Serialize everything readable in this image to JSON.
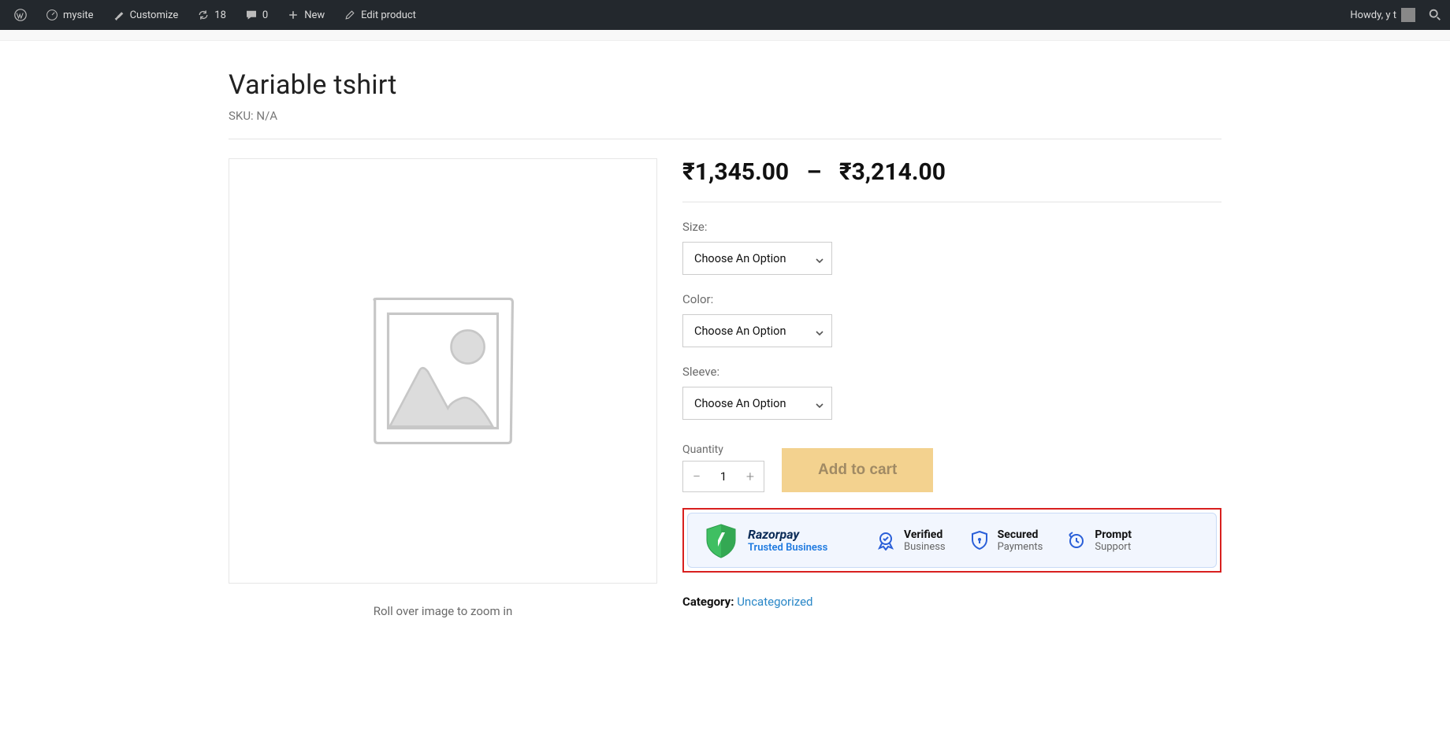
{
  "admin": {
    "site_name": "mysite",
    "customize": "Customize",
    "updates_count": "18",
    "comments_count": "0",
    "new": "New",
    "edit": "Edit product",
    "howdy": "Howdy, y t"
  },
  "product": {
    "title": "Variable tshirt",
    "sku_label": "SKU: ",
    "sku_value": "N/A",
    "price_low": "₹1,345.00",
    "price_sep": "–",
    "price_high": "₹3,214.00",
    "zoom_hint": "Roll over image to zoom in"
  },
  "options": {
    "size": {
      "label": "Size:",
      "placeholder": "Choose An Option"
    },
    "color": {
      "label": "Color:",
      "placeholder": "Choose An Option"
    },
    "sleeve": {
      "label": "Sleeve:",
      "placeholder": "Choose An Option"
    }
  },
  "cart": {
    "qty_label": "Quantity",
    "qty_value": "1",
    "add_label": "Add to cart"
  },
  "trust": {
    "brand": "Razorpay",
    "brand_sub": "Trusted Business",
    "items": [
      {
        "t1": "Verified",
        "t2": "Business"
      },
      {
        "t1": "Secured",
        "t2": "Payments"
      },
      {
        "t1": "Prompt",
        "t2": "Support"
      }
    ]
  },
  "category": {
    "label": "Category: ",
    "value": "Uncategorized"
  }
}
